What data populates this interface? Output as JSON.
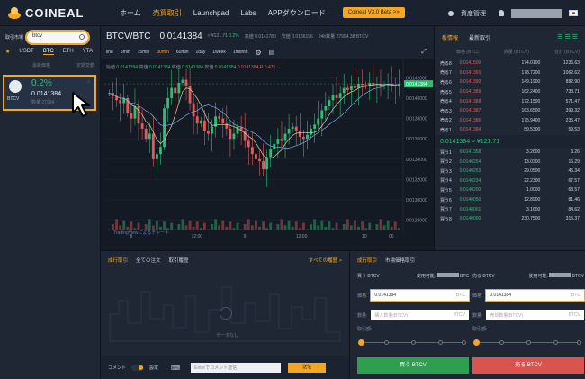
{
  "nav": {
    "logo": "COINEAL",
    "items": [
      "ホーム",
      "売買取引",
      "Launchpad",
      "Labs",
      "APPダウンロード"
    ],
    "active_index": 1,
    "beta": "Coineal V3.0 Beta >>",
    "asset": "資産管理"
  },
  "market": {
    "label": "取引市場",
    "search_value": "btcv",
    "tabs": [
      "★",
      "USDT",
      "BTC",
      "ETH",
      "YTA"
    ],
    "active_tab": 2,
    "col_price": "最新価格",
    "col_change": "定期変動",
    "pair": {
      "pct": "0.2%",
      "price": "0.0141384",
      "name": "BTCV",
      "vol": "数量 27994"
    }
  },
  "chart_head": {
    "pair": "BTCV/BTC",
    "last": "0.0141384",
    "fiat": "≈ ¥121.71",
    "change": "0.2%",
    "high_label": "高値",
    "high": "0.0141780",
    "low_label": "安値",
    "low": "0.0136196",
    "vol_label": "24h数量",
    "vol": "27994.38 BTCV"
  },
  "timeframes": [
    "line",
    "5min",
    "15min",
    "30min",
    "60min",
    "1day",
    "1week",
    "1month"
  ],
  "active_tf": 3,
  "legend": {
    "open_label": "始値",
    "open": "0.0141384",
    "high_label": "高値",
    "high": "0.0141384",
    "close_label": "終値",
    "close": "0.0141384",
    "low_label": "安値",
    "low": "0.0141384",
    "tail": "0.0141384 R 0.475"
  },
  "tv_label": "TradingViewによるチャート",
  "chart_data": {
    "type": "candlestick",
    "y_ticks": [
      "0.0142000",
      "0.0140000",
      "0.0138000",
      "0.0136000",
      "0.0134000",
      "0.0132000",
      "0.0130000",
      "0.0128000"
    ],
    "x_ticks": [
      "8",
      "12:00",
      "9",
      "12:00",
      "10",
      "06"
    ],
    "last_label": "0.0141384",
    "ylim": [
      0.0127,
      0.0143
    ],
    "values": [
      0.01405,
      0.01402,
      0.01398,
      0.01395,
      0.014,
      0.01385,
      0.0138,
      0.01392,
      0.01375,
      0.0137,
      0.0136,
      0.01365,
      0.0134,
      0.01345,
      0.01352,
      0.0139,
      0.014,
      0.0141,
      0.01405,
      0.01415,
      0.01418,
      0.01412,
      0.01395,
      0.01382,
      0.01375,
      0.01378,
      0.01368,
      0.01365,
      0.01372,
      0.01382,
      0.0138,
      0.01375,
      0.0137,
      0.0136,
      0.01365,
      0.01372,
      0.01368,
      0.01358,
      0.01352,
      0.01345,
      0.0134,
      0.01338,
      0.0133,
      0.01342,
      0.0135,
      0.01355,
      0.0136,
      0.01358,
      0.01365,
      0.0137,
      0.01372,
      0.01368,
      0.01362,
      0.0136,
      0.01364,
      0.0137,
      0.01374,
      0.0138,
      0.01388,
      0.01392,
      0.01398,
      0.01403,
      0.014,
      0.01405,
      0.0141,
      0.01408,
      0.01412,
      0.0141,
      0.01414,
      0.01413,
      0.01412,
      0.01415,
      0.01413,
      0.01414,
      0.01412,
      0.01413,
      0.01414,
      0.01413,
      0.01412,
      0.01414
    ]
  },
  "book": {
    "tabs": [
      "板情報",
      "最新取引"
    ],
    "active_tab": 0,
    "col_price": "価格 (BTC)",
    "col_amount": "数量 (BTCV)",
    "col_total": "合計 (BTCV)",
    "asks": [
      {
        "n": "売る8",
        "p": "0.0141500",
        "a": "174.0100",
        "t": "1236.63"
      },
      {
        "n": "売る7",
        "p": "0.0141391",
        "a": "178.7200",
        "t": "1062.62"
      },
      {
        "n": "売る6",
        "p": "0.0141390",
        "a": "149.1900",
        "t": "882.90"
      },
      {
        "n": "売る5",
        "p": "0.0141389",
        "a": "162.2400",
        "t": "733.71"
      },
      {
        "n": "売る4",
        "p": "0.0141388",
        "a": "172.1500",
        "t": "571.47"
      },
      {
        "n": "売る3",
        "p": "0.0141387",
        "a": "163.6500",
        "t": "399.32"
      },
      {
        "n": "売る2",
        "p": "0.0141386",
        "a": "175.9400",
        "t": "235.47"
      },
      {
        "n": "売る1",
        "p": "0.0141384",
        "a": "59.5300",
        "t": "59.53"
      }
    ],
    "mid": "0.0141384 ≈ ¥121.71",
    "bids": [
      {
        "n": "買う1",
        "p": "0.0141358",
        "a": "3.2600",
        "t": "3.26"
      },
      {
        "n": "買う2",
        "p": "0.0140254",
        "a": "13.0300",
        "t": "16.29"
      },
      {
        "n": "買う3",
        "p": "0.0140253",
        "a": "29.0500",
        "t": "45.34"
      },
      {
        "n": "買う4",
        "p": "0.0140234",
        "a": "22.2300",
        "t": "67.57"
      },
      {
        "n": "買う5",
        "p": "0.0140200",
        "a": "1.0000",
        "t": "68.57"
      },
      {
        "n": "買う6",
        "p": "0.0140050",
        "a": "12.8900",
        "t": "81.46"
      },
      {
        "n": "買う7",
        "p": "0.0140001",
        "a": "3.1600",
        "t": "84.62"
      },
      {
        "n": "買う8",
        "p": "0.0140000",
        "a": "230.7500",
        "t": "315.37"
      }
    ]
  },
  "orders": {
    "tabs": [
      "成行取引",
      "全ての注文",
      "取引履歴"
    ],
    "active_tab": 0,
    "history": "すべての履歴 >",
    "nodata": "データなし",
    "comment_label": "コメント",
    "settings": "設定",
    "comment_placeholder": "Enterでコメント送信",
    "send": "送信"
  },
  "trade": {
    "tabs": [
      "成行取引",
      "市場価格取引"
    ],
    "active_tab": 0,
    "buy": {
      "title": "買う BTCV",
      "avail": "使用可能:",
      "unit": "BTC",
      "price_label": "価格:",
      "price": "0.0141384",
      "price_unit": "BTC",
      "qty_label": "数量:",
      "qty_ph": "購入数量(BTCV)",
      "qty_unit": "BTCV",
      "amount_label": "取引額:",
      "button": "買う BTCV"
    },
    "sell": {
      "title": "売る BTCV",
      "avail": "使用可能:",
      "unit": "BTCV",
      "price_label": "価格:",
      "price": "0.0141384",
      "price_unit": "BTC",
      "qty_label": "数量:",
      "qty_ph": "売却数量(BTCV)",
      "qty_unit": "BTCV",
      "amount_label": "取引額:",
      "button": "売る BTCV"
    }
  },
  "colors": {
    "accent": "#f5a623",
    "up": "#2ebd72",
    "down": "#e35a5a",
    "buy": "#2e9e4f",
    "sell": "#d9534f"
  }
}
